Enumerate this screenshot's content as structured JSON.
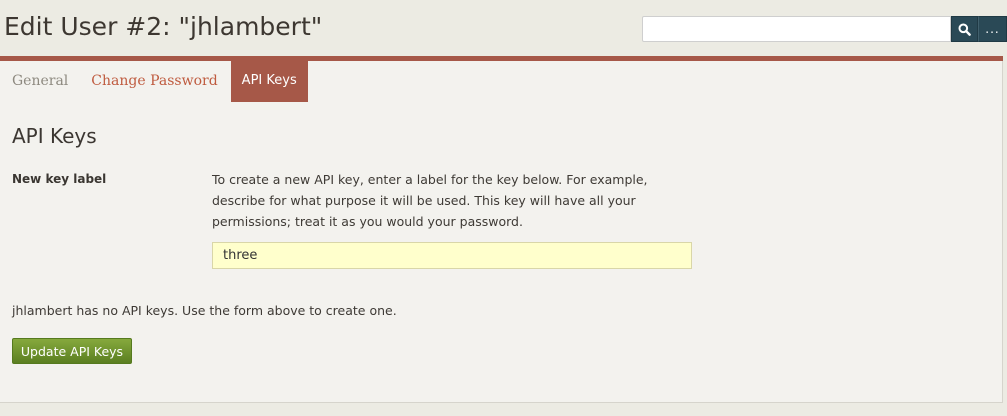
{
  "header": {
    "title": "Edit User #2: \"jhlambert\""
  },
  "search": {
    "value": "",
    "placeholder": "",
    "submit_icon": "search-icon",
    "more_label": "..."
  },
  "colors": {
    "accent": "#a65848",
    "search_button": "#2a4956",
    "input_highlight": "#ffffcc",
    "primary_button": "#6a9030"
  },
  "tabs": [
    {
      "label": "General",
      "active": false
    },
    {
      "label": "Change Password",
      "active": false
    },
    {
      "label": "API Keys",
      "active": true
    }
  ],
  "api_keys": {
    "heading": "API Keys",
    "field_label": "New key label",
    "help_text": "To create a new API key, enter a label for the key below. For example, describe for what purpose it will be used. This key will have all your permissions; treat it as you would your password.",
    "input_value": "three",
    "empty_message": "jhlambert has no API keys. Use the form above to create one.",
    "submit_label": "Update API Keys"
  }
}
